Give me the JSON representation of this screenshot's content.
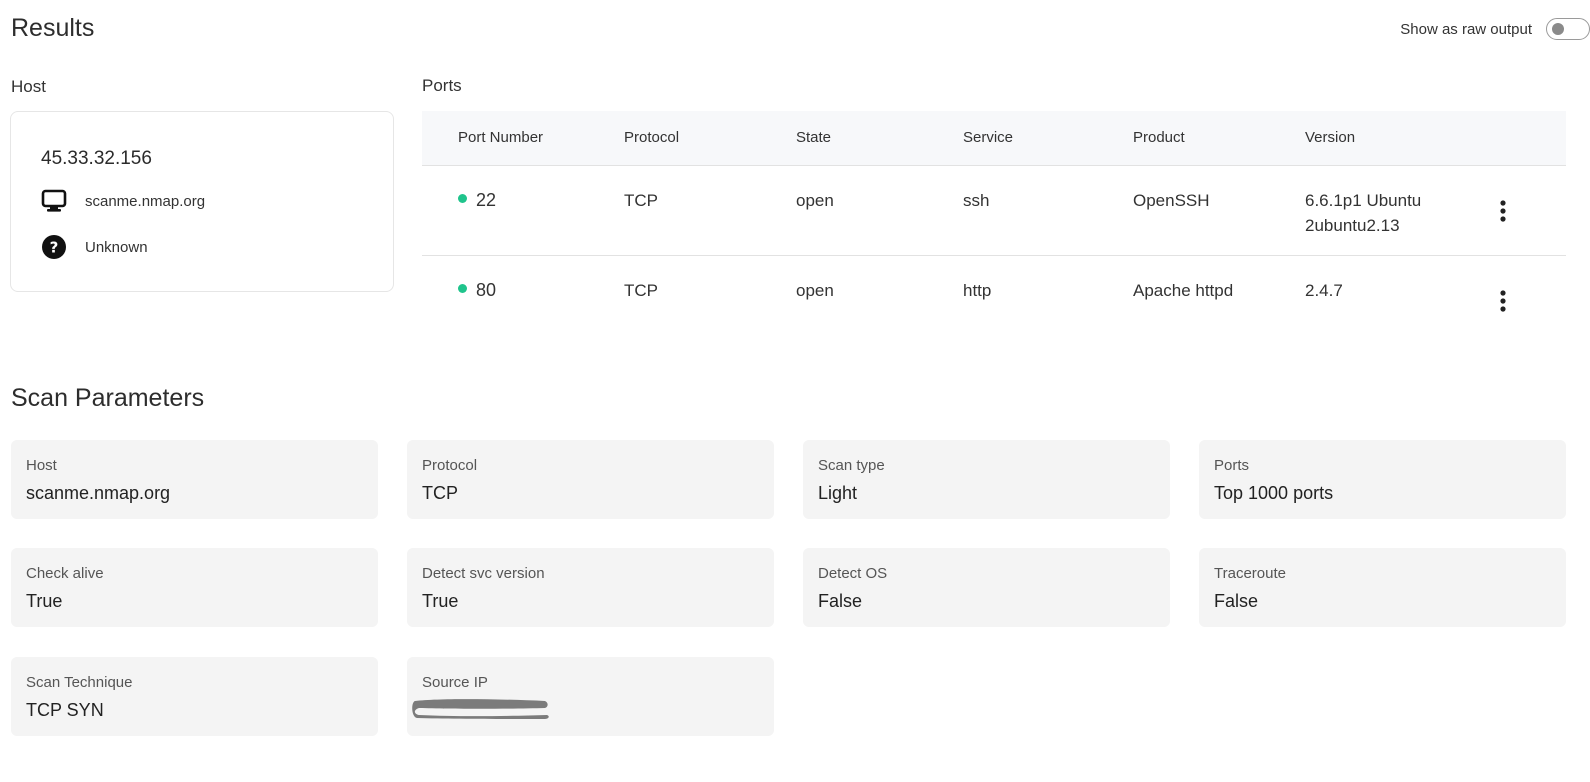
{
  "results": {
    "title": "Results",
    "raw_toggle_label": "Show as raw output"
  },
  "host": {
    "heading": "Host",
    "ip": "45.33.32.156",
    "hostname": "scanme.nmap.org",
    "os": "Unknown"
  },
  "ports": {
    "heading": "Ports",
    "columns": [
      "Port Number",
      "Protocol",
      "State",
      "Service",
      "Product",
      "Version"
    ],
    "rows": [
      {
        "port": "22",
        "protocol": "TCP",
        "state": "open",
        "service": "ssh",
        "product": "OpenSSH",
        "version": "6.6.1p1 Ubuntu 2ubuntu2.13"
      },
      {
        "port": "80",
        "protocol": "TCP",
        "state": "open",
        "service": "http",
        "product": "Apache httpd",
        "version": "2.4.7"
      }
    ],
    "status_color": "#1fc48c"
  },
  "scan_parameters": {
    "heading": "Scan Parameters",
    "items": [
      {
        "label": "Host",
        "value": "scanme.nmap.org"
      },
      {
        "label": "Protocol",
        "value": "TCP"
      },
      {
        "label": "Scan type",
        "value": "Light"
      },
      {
        "label": "Ports",
        "value": "Top 1000 ports"
      },
      {
        "label": "Check alive",
        "value": "True"
      },
      {
        "label": "Detect svc version",
        "value": "True"
      },
      {
        "label": "Detect OS",
        "value": "False"
      },
      {
        "label": "Traceroute",
        "value": "False"
      },
      {
        "label": "Scan Technique",
        "value": "TCP SYN"
      },
      {
        "label": "Source IP",
        "value": ""
      }
    ]
  },
  "icons": {
    "hostname": "monitor-icon",
    "os": "question-circle-icon",
    "row_menu": "kebab-menu-icon"
  }
}
